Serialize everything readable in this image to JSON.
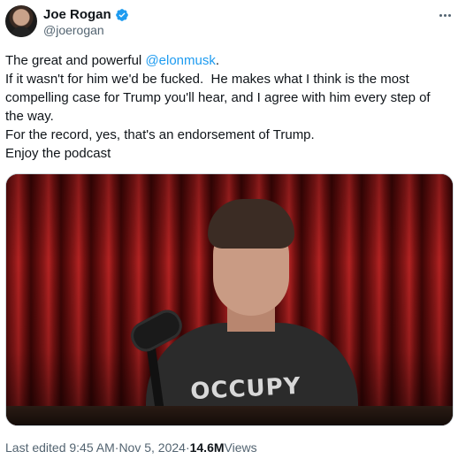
{
  "author": {
    "display_name": "Joe Rogan",
    "handle": "@joerogan",
    "verified": true,
    "avatar_icon": "avatar-photo"
  },
  "more_icon": "more-horizontal-icon",
  "tweet_text": {
    "line1_prefix": "The great and powerful ",
    "line1_mention": "@elonmusk",
    "line1_suffix": ".",
    "line2": "If it wasn't for him we'd be fucked.  He makes what I think is the most",
    "line3": "compelling case for Trump you'll hear, and I agree with him every step of",
    "line4": "the way.",
    "line5": "For the record, yes, that's an endorsement of Trump.",
    "line6": "Enjoy the podcast"
  },
  "media": {
    "shirt_text": "OCCUPY"
  },
  "meta": {
    "edited_time": "Last edited 9:45 AM",
    "separator1": " · ",
    "date": "Nov 5, 2024",
    "separator2": " · ",
    "views_count": "14.6M",
    "views_label": " Views"
  },
  "colors": {
    "link": "#1d9bf0",
    "text": "#0f1419",
    "secondary": "#536471",
    "verified": "#1d9bf0"
  }
}
